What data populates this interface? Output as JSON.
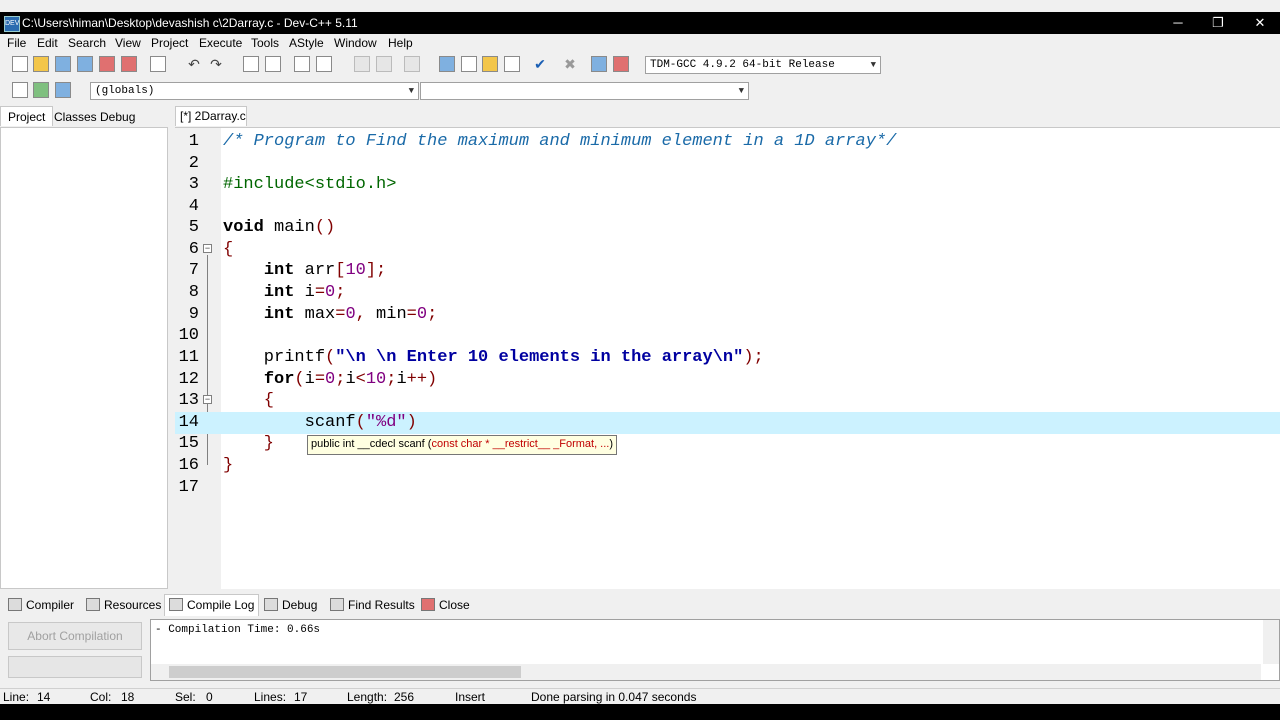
{
  "window": {
    "title": "C:\\Users\\himan\\Desktop\\devashish c\\2Darray.c - Dev-C++ 5.11",
    "icon_label": "DEV",
    "minimize": "─",
    "maximize": "❐",
    "close": "✕"
  },
  "menu": [
    "File",
    "Edit",
    "Search",
    "View",
    "Project",
    "Execute",
    "Tools",
    "AStyle",
    "Window",
    "Help"
  ],
  "toolbar": {
    "compiler_select": "TDM-GCC 4.9.2 64-bit Release",
    "globals_select": "(globals)",
    "function_select": ""
  },
  "left_tabs": [
    "Project",
    "Classes",
    "Debug"
  ],
  "editor_tab": "[*] 2Darray.c",
  "code_lines": [
    "/* Program to Find the maximum and minimum element in a 1D array*/",
    "",
    "#include<stdio.h>",
    "",
    "void main()",
    "{",
    "    int arr[10];",
    "    int i=0;",
    "    int max=0, min=0;",
    "",
    "    printf(\"\\n \\n Enter 10 elements in the array\\n\");",
    "    for(i=0;i<10;i++)",
    "    {",
    "        scanf(\"%d\")",
    "    }",
    "}",
    ""
  ],
  "line_numbers": [
    "1",
    "2",
    "3",
    "4",
    "5",
    "6",
    "7",
    "8",
    "9",
    "10",
    "11",
    "12",
    "13",
    "14",
    "15",
    "16",
    "17"
  ],
  "tooltip": {
    "prefix": "public int __cdecl scanf (",
    "params": "const char * __restrict__ _Format, ...",
    "suffix": ")"
  },
  "bottom_tabs": [
    "Compiler",
    "Resources",
    "Compile Log",
    "Debug",
    "Find Results",
    "Close"
  ],
  "abort_button": "Abort Compilation",
  "log_text": "- Compilation Time: 0.66s",
  "status": {
    "line_label": "Line:",
    "line_value": "14",
    "col_label": "Col:",
    "col_value": "18",
    "sel_label": "Sel:",
    "sel_value": "0",
    "lines_label": "Lines:",
    "lines_value": "17",
    "length_label": "Length:",
    "length_value": "256",
    "mode": "Insert",
    "message": "Done parsing in 0.047 seconds"
  }
}
